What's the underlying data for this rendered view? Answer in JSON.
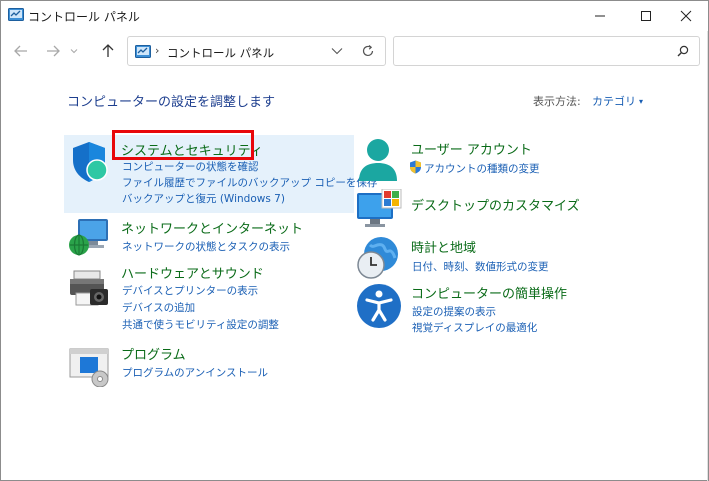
{
  "window": {
    "title": "コントロール パネル"
  },
  "nav": {
    "breadcrumb": "コントロール パネル",
    "search_placeholder": ""
  },
  "content": {
    "heading": "コンピューターの設定を調整します",
    "view_by_label": "表示方法:",
    "view_by_value": "カテゴリ"
  },
  "categories": {
    "system": {
      "title": "システムとセキュリティ",
      "links": [
        "コンピューターの状態を確認",
        "ファイル履歴でファイルのバックアップ コピーを保存",
        "バックアップと復元 (Windows 7)"
      ]
    },
    "network": {
      "title": "ネットワークとインターネット",
      "links": [
        "ネットワークの状態とタスクの表示"
      ]
    },
    "hardware": {
      "title": "ハードウェアとサウンド",
      "links": [
        "デバイスとプリンターの表示",
        "デバイスの追加",
        "共通で使うモビリティ設定の調整"
      ]
    },
    "programs": {
      "title": "プログラム",
      "links": [
        "プログラムのアンインストール"
      ]
    },
    "user": {
      "title": "ユーザー アカウント",
      "links": [
        "アカウントの種類の変更"
      ]
    },
    "desktop": {
      "title": "デスクトップのカスタマイズ",
      "links": []
    },
    "clock": {
      "title": "時計と地域",
      "links": [
        "日付、時刻、数値形式の変更"
      ]
    },
    "ease": {
      "title": "コンピューターの簡単操作",
      "links": [
        "設定の提案の表示",
        "視覚ディスプレイの最適化"
      ]
    }
  },
  "colors": {
    "title_green": "#0a6b18",
    "link_blue": "#1a5fb4",
    "heading_blue": "#1e3f8f",
    "highlight_bg": "#e5f1fb",
    "annotation_red": "#e8070a"
  }
}
